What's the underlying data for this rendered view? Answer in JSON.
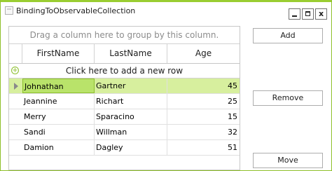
{
  "window": {
    "title": "BindingToObservableCollection",
    "minimize_label": "",
    "maximize_label": "",
    "close_label": "x"
  },
  "grid": {
    "group_panel_text": "Drag a column here to group by this column.",
    "columns": [
      "FirstName",
      "LastName",
      "Age"
    ],
    "new_row_text": "Click here to add a new row",
    "rows": [
      {
        "first": "Johnathan",
        "last": "Gartner",
        "age": "45"
      },
      {
        "first": "Jeannine",
        "last": "Richart",
        "age": "25"
      },
      {
        "first": "Merry",
        "last": "Sparacino",
        "age": "15"
      },
      {
        "first": "Sandi",
        "last": "Willman",
        "age": "32"
      },
      {
        "first": "Damion",
        "last": "Dagley",
        "age": "51"
      }
    ],
    "selected_row_index": 0
  },
  "buttons": {
    "add": "Add",
    "remove": "Remove",
    "move": "Move"
  },
  "colors": {
    "accent": "#9acd32",
    "selected_row": "#d7ef9e",
    "selected_cell": "#b9e36a"
  }
}
